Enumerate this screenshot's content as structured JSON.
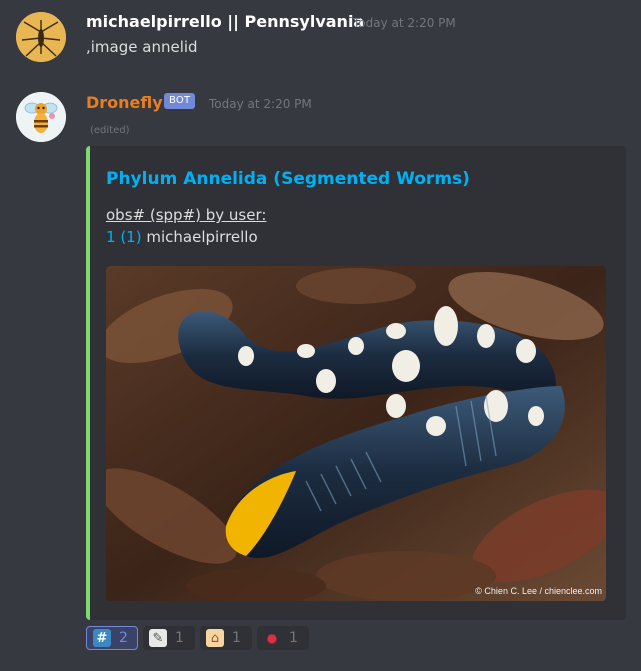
{
  "messages": [
    {
      "username": "michaelpirrello || Pennsylvania",
      "timestamp": "Today at 2:20 PM",
      "content": ",image annelid",
      "name_color": "#ffffff"
    },
    {
      "username": "Dronefly",
      "bot_tag": "BOT",
      "timestamp": "Today at 2:20 PM",
      "edited": "(edited)",
      "name_color": "#e67e22",
      "embed": {
        "title": "Phylum Annelida (Segmented Worms)",
        "desc_line1": "obs# (spp#) by user:",
        "obs_count": "1",
        "spp_count": "(1)",
        "user": "michaelpirrello",
        "image_credit": "© Chien C. Lee / chienclee.com",
        "accent": "#7ed86e"
      }
    }
  ],
  "reactions": [
    {
      "icon": "hash-keycap-icon",
      "glyph": "#",
      "count": "2",
      "active": true
    },
    {
      "icon": "memo-icon",
      "glyph": "✎",
      "count": "1",
      "active": false
    },
    {
      "icon": "house-icon",
      "glyph": "⌂",
      "count": "1",
      "active": false
    },
    {
      "icon": "round-pushpin-icon",
      "glyph": "●",
      "count": "1",
      "active": false
    }
  ]
}
